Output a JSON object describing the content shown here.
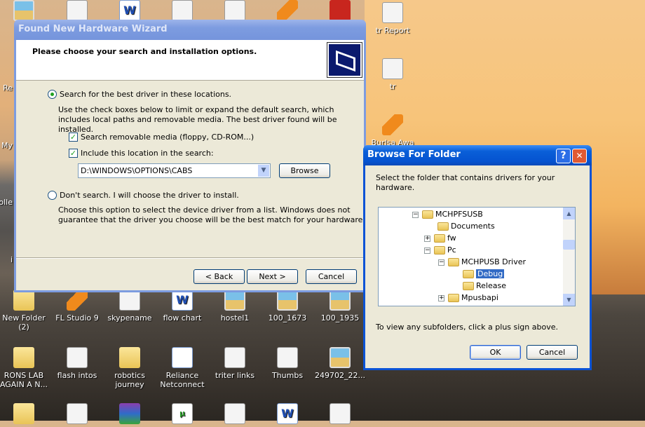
{
  "desktop": {
    "top_row": [
      {
        "label": "",
        "type": "computer"
      },
      {
        "label": "",
        "type": "pdf"
      },
      {
        "label": "",
        "type": "word"
      },
      {
        "label": "",
        "type": "doc"
      },
      {
        "label": "",
        "type": "doc"
      },
      {
        "label": "",
        "type": "vlc"
      },
      {
        "label": "",
        "type": "red"
      }
    ],
    "right_column": [
      {
        "label": "tr Report",
        "type": "doc"
      },
      {
        "label": "tr",
        "type": "flash"
      },
      {
        "label": "Burlsa Awa",
        "type": "vlc"
      }
    ],
    "left_partial": [
      "Re",
      "My",
      "colle",
      "i"
    ],
    "row1": [
      {
        "label": "New Folder (2)",
        "type": "folder"
      },
      {
        "label": "FL Studio 9",
        "type": "fl"
      },
      {
        "label": "skypename",
        "type": "doc"
      },
      {
        "label": "flow chart",
        "type": "word"
      },
      {
        "label": "hostel1",
        "type": "img"
      },
      {
        "label": "100_1673",
        "type": "img"
      },
      {
        "label": "100_1935",
        "type": "img"
      }
    ],
    "row2": [
      {
        "label": "RONS LAB AGAIN A N...",
        "type": "folder"
      },
      {
        "label": "flash intos",
        "type": "doc"
      },
      {
        "label": "robotics journey",
        "type": "folder"
      },
      {
        "label": "Reliance Netconnect",
        "type": "net"
      },
      {
        "label": "triter links",
        "type": "doc"
      },
      {
        "label": "Thumbs",
        "type": "thumbs"
      },
      {
        "label": "249702_22...",
        "type": "img"
      }
    ],
    "row3": [
      {
        "label": "",
        "type": "folder"
      },
      {
        "label": "",
        "type": "doc"
      },
      {
        "label": "",
        "type": "zip"
      },
      {
        "label": "",
        "type": "green"
      },
      {
        "label": "",
        "type": "doc"
      },
      {
        "label": "",
        "type": "word"
      },
      {
        "label": "",
        "type": "doc"
      }
    ]
  },
  "wizard": {
    "title": "Found New Hardware Wizard",
    "heading": "Please choose your search and installation options.",
    "option_search": "Search for the best driver in these locations.",
    "option_search_selected": true,
    "search_desc": "Use the check boxes below to limit or expand the default search, which includes local paths and removable media. The best driver found will be installed.",
    "check_removable": "Search removable media (floppy, CD-ROM...)",
    "check_removable_checked": true,
    "check_include": "Include this location in the search:",
    "check_include_checked": true,
    "location_value": "D:\\WINDOWS\\OPTIONS\\CABS",
    "browse": "Browse",
    "option_dont": "Don't search. I will choose the driver to install.",
    "dont_desc": "Choose this option to select the device driver from a list.  Windows does not guarantee that the driver you choose will be the best match for your hardware.",
    "back": "< Back",
    "next": "Next >",
    "cancel": "Cancel"
  },
  "browse": {
    "title": "Browse For Folder",
    "instruction": "Select the folder that contains drivers for your hardware.",
    "tree": [
      {
        "label": "MCHPFSUSB",
        "level": 0,
        "expander": "−"
      },
      {
        "label": "Documents",
        "level": 1,
        "expander": ""
      },
      {
        "label": "fw",
        "level": 1,
        "expander": "+"
      },
      {
        "label": "Pc",
        "level": 1,
        "expander": "−"
      },
      {
        "label": "MCHPUSB Driver",
        "level": 2,
        "expander": "−"
      },
      {
        "label": "Debug",
        "level": 3,
        "expander": "",
        "selected": true
      },
      {
        "label": "Release",
        "level": 3,
        "expander": ""
      },
      {
        "label": "Mpusbapi",
        "level": 2,
        "expander": "+"
      }
    ],
    "hint": "To view any subfolders, click a plus sign above.",
    "ok": "OK",
    "cancel": "Cancel",
    "help": "?",
    "close": "✕"
  },
  "colors": {
    "active_title": "#0a5fd8",
    "inactive_title": "#7d9ce0",
    "selection": "#316ac5",
    "dialog_bg": "#ece9d8"
  }
}
